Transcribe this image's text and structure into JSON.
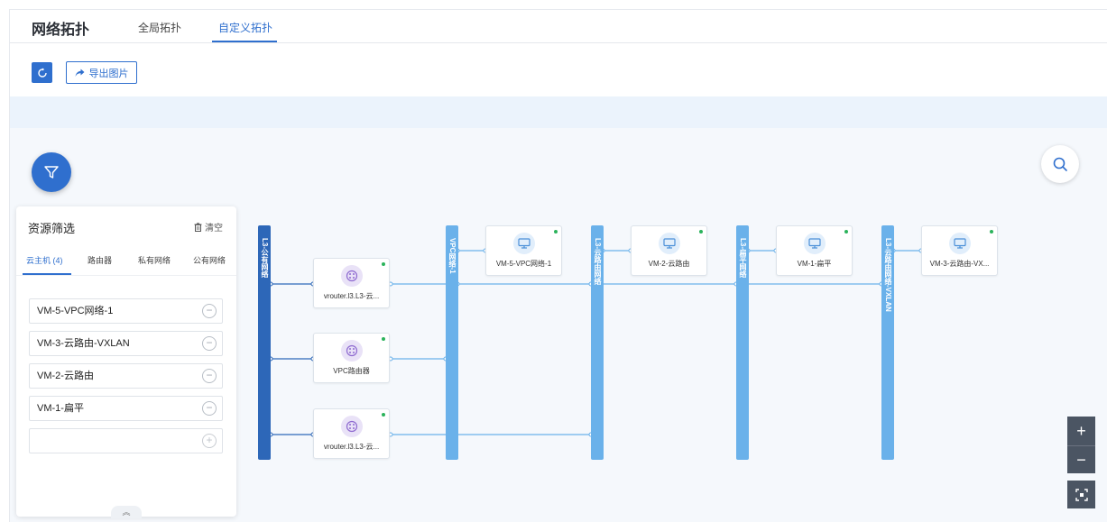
{
  "header": {
    "title": "网络拓扑",
    "tabs": [
      {
        "label": "全局拓扑",
        "active": false
      },
      {
        "label": "自定义拓扑",
        "active": true
      }
    ]
  },
  "toolbar": {
    "refresh_icon": "refresh-icon",
    "export_label": "导出图片"
  },
  "filter_panel": {
    "title": "资源筛选",
    "clear_label": "清空",
    "tabs": [
      "云主机 (4)",
      "路由器",
      "私有网络",
      "公有网络"
    ],
    "items": [
      "VM-5-VPC网络-1",
      "VM-3-云路由-VXLAN",
      "VM-2-云路由",
      "VM-1-扁平"
    ]
  },
  "topology": {
    "networks": [
      {
        "label": "L3-公有网络",
        "style": "dark"
      },
      {
        "label": "VPC网络-1",
        "style": "light"
      },
      {
        "label": "L3-云路由网络",
        "style": "light"
      },
      {
        "label": "L3-扁平网络",
        "style": "light"
      },
      {
        "label": "L3-云路由网络-VXLAN",
        "style": "light"
      }
    ],
    "routers": [
      {
        "label": "vrouter.l3.L3-云..."
      },
      {
        "label": "VPC路由器"
      },
      {
        "label": "vrouter.l3.L3-云..."
      }
    ],
    "vms": [
      {
        "label": "VM-5-VPC网络-1"
      },
      {
        "label": "VM-2-云路由"
      },
      {
        "label": "VM-1-扁平"
      },
      {
        "label": "VM-3-云路由-VX..."
      }
    ]
  },
  "colors": {
    "accent": "#2f6fce",
    "bus_dark": "#2d67b8",
    "bus_light": "#6ab1ea",
    "running_status": "#2bb35b"
  },
  "controls": {
    "zoom_in": "+",
    "zoom_out": "−"
  }
}
